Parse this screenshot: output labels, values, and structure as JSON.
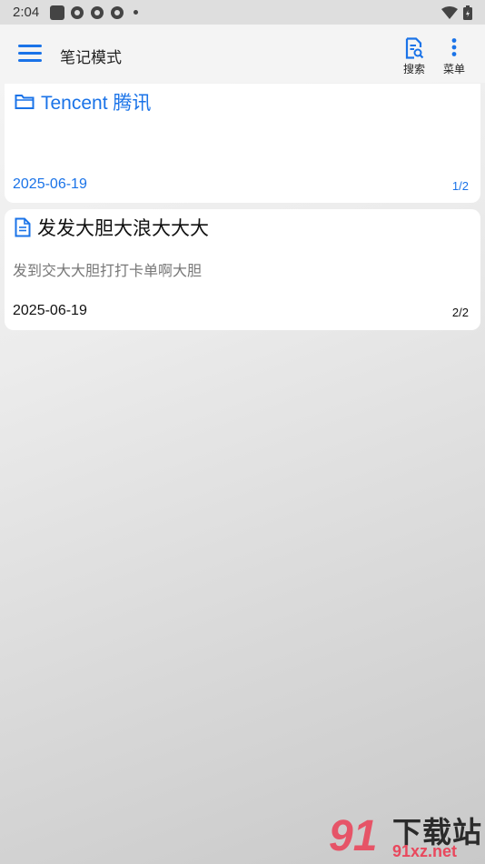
{
  "status_bar": {
    "time": "2:04"
  },
  "app_bar": {
    "title": "笔记模式",
    "search_label": "搜索",
    "menu_label": "菜单",
    "accent_color": "#1a73e8"
  },
  "notes": [
    {
      "type": "folder",
      "icon": "folder-icon",
      "title": "Tencent 腾讯",
      "preview": "",
      "date": "2025-06-19",
      "page": "1/2"
    },
    {
      "type": "note",
      "icon": "document-icon",
      "title": "发发大胆大浪大大大",
      "preview": "发到交大大胆打打卡单啊大胆",
      "date": "2025-06-19",
      "page": "2/2"
    }
  ],
  "watermark": {
    "logo": "91",
    "brand": "下载站",
    "url": "91xz.net"
  }
}
